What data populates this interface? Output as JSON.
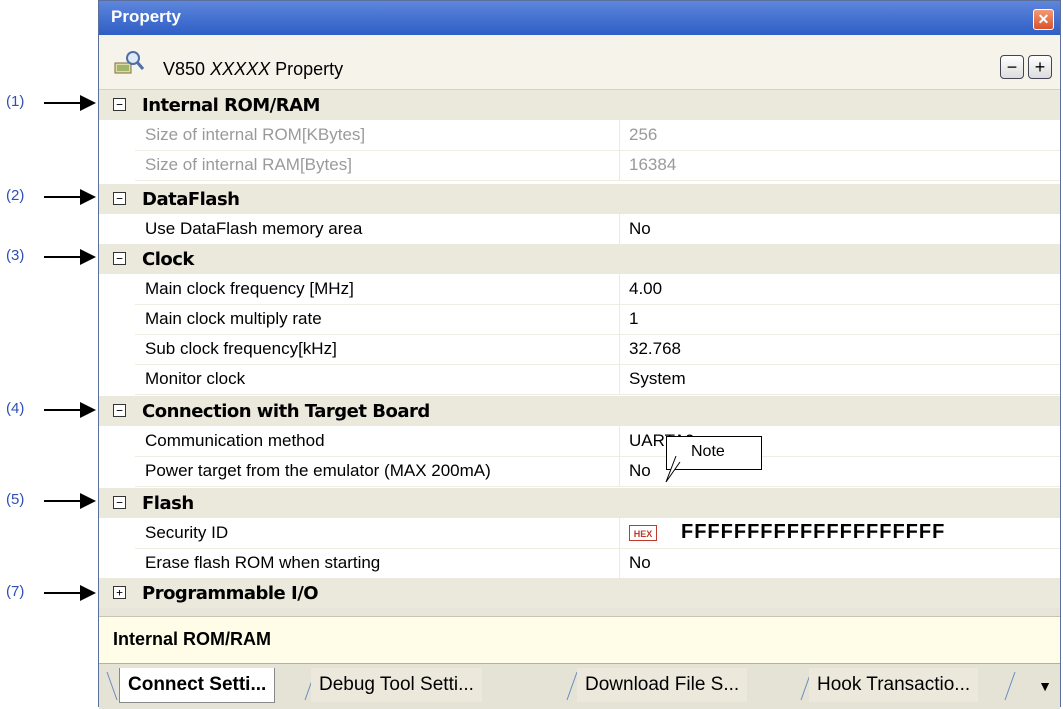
{
  "callouts": [
    "(1)",
    "(2)",
    "(3)",
    "(4)",
    "(5)",
    "(7)"
  ],
  "window": {
    "title": "Property",
    "header_prefix": "V850",
    "header_model": "XXXXX",
    "header_suffix": "Property",
    "minus_label": "−",
    "plus_label": "+"
  },
  "categories": [
    {
      "label": "Internal ROM/RAM",
      "toggle": "−",
      "rows": [
        {
          "key": "Size of internal ROM[KBytes]",
          "value": "256"
        },
        {
          "key": "Size of internal RAM[Bytes]",
          "value": "16384"
        }
      ]
    },
    {
      "label": "DataFlash",
      "toggle": "−",
      "rows": [
        {
          "key": "Use DataFlash memory area",
          "value": "No"
        }
      ]
    },
    {
      "label": "Clock",
      "toggle": "−",
      "rows": [
        {
          "key": "Main clock frequency [MHz]",
          "value": "4.00"
        },
        {
          "key": "Main clock multiply rate",
          "value": "1"
        },
        {
          "key": "Sub clock frequency[kHz]",
          "value": "32.768"
        },
        {
          "key": "Monitor clock",
          "value": "System"
        }
      ]
    },
    {
      "label": "Connection with Target Board",
      "toggle": "−",
      "rows": [
        {
          "key": "Communication method",
          "value": "UARTA0"
        },
        {
          "key": "Power target from the emulator (MAX 200mA)",
          "value": "No"
        }
      ]
    },
    {
      "label": "Flash",
      "toggle": "−",
      "rows": [
        {
          "key": "Security ID",
          "value": "FFFFFFFFFFFFFFFFFFFF",
          "badge": "HEX"
        },
        {
          "key": "Erase flash ROM when starting",
          "value": "No"
        }
      ]
    },
    {
      "label": "Programmable I/O",
      "toggle": "+",
      "rows": []
    }
  ],
  "note": "Note",
  "description": "Internal ROM/RAM",
  "tabs": [
    "Connect Setti...",
    "Debug Tool Setti...",
    "Download File S...",
    "Hook Transactio..."
  ],
  "tab_menu": "▼",
  "close_glyph": "✕"
}
